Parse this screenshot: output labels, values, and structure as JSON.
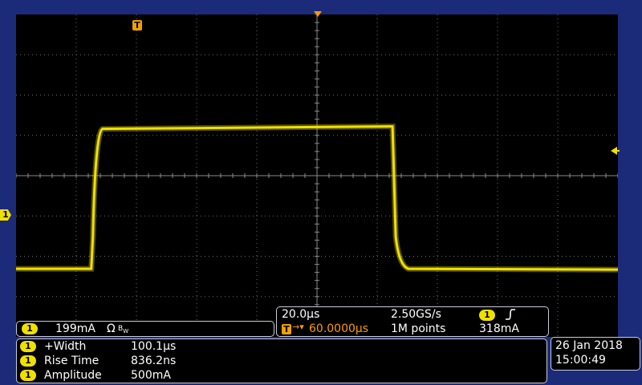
{
  "colors": {
    "trace": "#f0e000",
    "grid": "#6e6e6e",
    "bezel": "#1c2a7a",
    "trigger": "#ff9a00"
  },
  "trigger_marker": {
    "label": "T"
  },
  "channel_marker": {
    "label": "1"
  },
  "trace": {
    "low_level": 0.2,
    "high_level": 0.9,
    "rise_start_us": 25.0,
    "fall_start_us": 125.1,
    "x_range_us": [
      0,
      200
    ],
    "y_range": [
      0,
      1.5
    ]
  },
  "channel_panel": {
    "channel": "1",
    "scale": "199mA",
    "suffix": "Ω",
    "bw_icon": "bandwidth-limit-icon"
  },
  "horizontal": {
    "time_div": "20.0µs",
    "sample_rate": "2.50GS/s",
    "trigger_channel": "1",
    "trigger_slope_icon": "rising-edge-icon",
    "delay": "60.0000µs",
    "record_length": "1M points",
    "trigger_level": "318mA"
  },
  "measurements": [
    {
      "channel": "1",
      "name": "+Width",
      "value": "100.1µs"
    },
    {
      "channel": "1",
      "name": "Rise Time",
      "value": "836.2ns"
    },
    {
      "channel": "1",
      "name": "Amplitude",
      "value": "500mA"
    }
  ],
  "datetime": {
    "date": "26 Jan 2018",
    "time": "15:00:49"
  }
}
